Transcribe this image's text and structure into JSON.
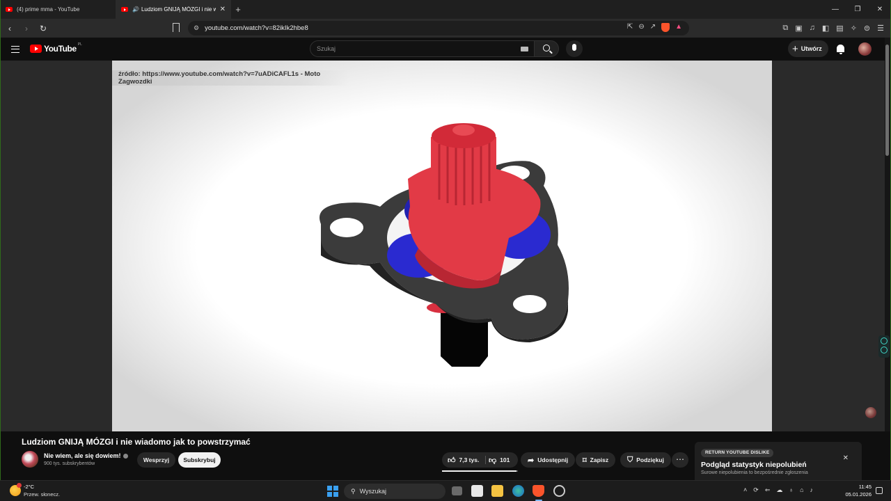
{
  "browser": {
    "tabs": [
      {
        "title": "(4) prime mma - YouTube"
      },
      {
        "title": "Ludziom GNIJĄ MÓZGI i nie w"
      }
    ],
    "url": "youtube.com/watch?v=82ikIk2hbe8"
  },
  "youtube": {
    "logo_text": "YouTube",
    "region": "PL",
    "search_placeholder": "Szukaj",
    "create_label": "Utwórz"
  },
  "video": {
    "source_note": "źródło: https://www.youtube.com/watch?v=7uADiCAFL1s - Moto Zagwozdki",
    "title": "Ludziom GNIJĄ MÓZGI i nie wiadomo jak to powstrzymać"
  },
  "channel": {
    "name": "Nie wiem, ale się dowiem!",
    "subscribers": "900 tys. subskrybentów",
    "support_label": "Wesprzyj",
    "subscribe_label": "Subskrybuj"
  },
  "actions": {
    "likes": "7,3 tys.",
    "dislikes": "101",
    "like_ratio": 0.986,
    "share": "Udostępnij",
    "save": "Zapisz",
    "thanks": "Podziękuj",
    "more": "⋯"
  },
  "ryd_popup": {
    "badge": "RETURN YOUTUBE DISLIKE",
    "title": "Podgląd statystyk niepolubień",
    "subtitle": "Surowe niepolubienia to bezpośrednie zgłoszenia"
  },
  "taskbar": {
    "temperature": "-2°C",
    "weather": "Przew. słonecz.",
    "search_label": "Wyszukaj",
    "time": "11:45",
    "date": "05.01.2026"
  }
}
